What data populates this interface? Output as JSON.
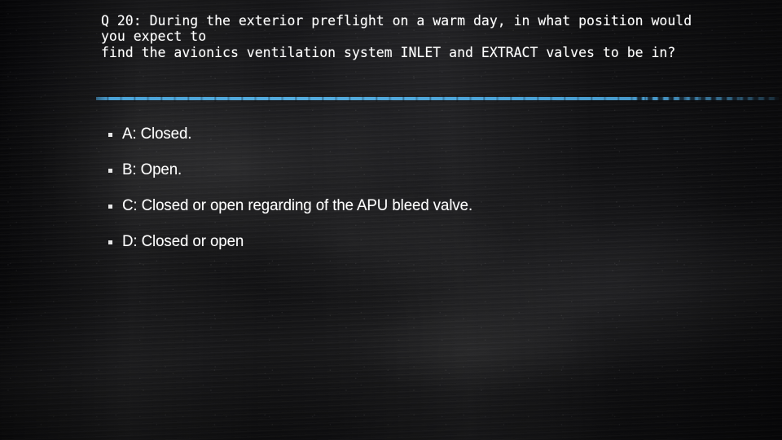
{
  "slide": {
    "background_color": "#0b0b0d",
    "surface": "chalkboard"
  },
  "question": {
    "text": "Q 20: During the exterior preflight on a warm day, in what position would you expect to\nfind the avionics ventilation system INLET and EXTRACT valves to be in?"
  },
  "divider": {
    "color": "#4ba3d8",
    "style": "chalk-line"
  },
  "options": [
    {
      "bullet": "square-bullet-icon",
      "label": "A: Closed."
    },
    {
      "bullet": "square-bullet-icon",
      "label": "B: Open."
    },
    {
      "bullet": "square-bullet-icon",
      "label": "C: Closed or open regarding of the APU bleed valve."
    },
    {
      "bullet": "square-bullet-icon",
      "label": "D: Closed or open"
    }
  ]
}
